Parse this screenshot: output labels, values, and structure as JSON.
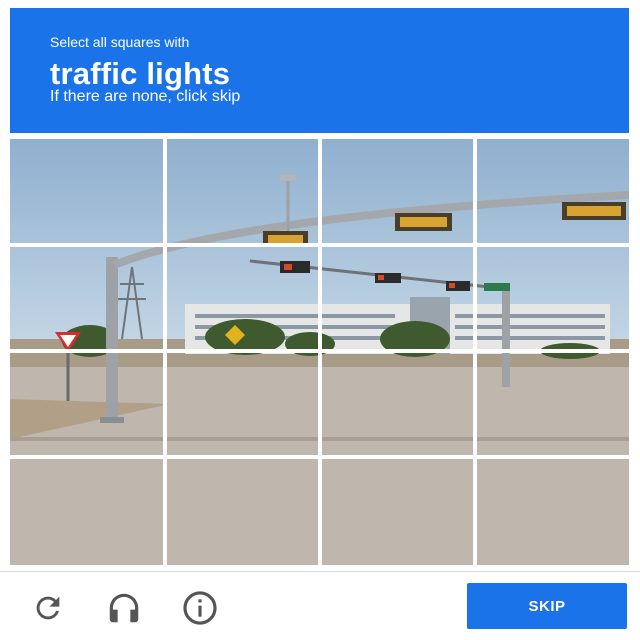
{
  "header": {
    "prompt": "Select all squares with",
    "target": "traffic lights",
    "hint": "If there are none, click skip"
  },
  "grid": {
    "rows": 4,
    "cols": 4
  },
  "footer": {
    "reload_icon": "reload-icon",
    "audio_icon": "headphones-icon",
    "info_icon": "info-icon",
    "skip_label": "SKIP"
  },
  "colors": {
    "accent": "#1a73e8",
    "icon": "#555555"
  }
}
